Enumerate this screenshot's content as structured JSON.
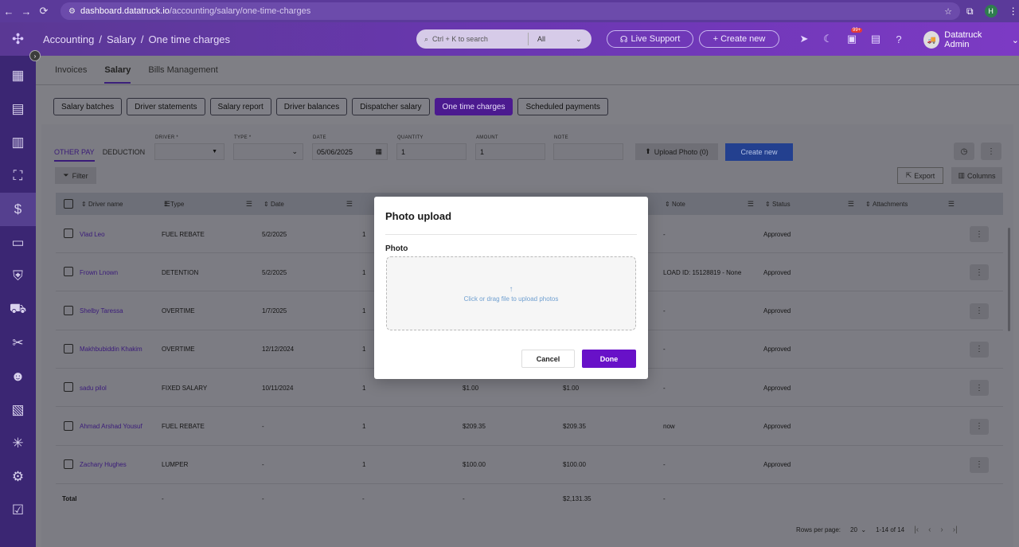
{
  "browser": {
    "url_host": "dashboard.datatruck.io",
    "url_path": "/accounting/salary/one-time-charges",
    "profile_initial": "H"
  },
  "header": {
    "breadcrumb": [
      "Accounting",
      "/",
      "Salary",
      "/",
      "One time charges"
    ],
    "search_placeholder": "Ctrl + K to search",
    "search_scope": "All",
    "live_support": "Live Support",
    "create_new": "+ Create new",
    "notif_badge": "99+",
    "user_name": "Datatruck Admin"
  },
  "tabs": [
    "Invoices",
    "Salary",
    "Bills Management"
  ],
  "active_tab": "Salary",
  "subtabs": [
    "Salary batches",
    "Driver statements",
    "Salary report",
    "Driver balances",
    "Dispatcher salary",
    "One time charges",
    "Scheduled payments"
  ],
  "active_subtab": "One time charges",
  "mode_tabs": [
    "OTHER PAY",
    "DEDUCTION"
  ],
  "form": {
    "driver_label": "DRIVER *",
    "type_label": "TYPE *",
    "date_label": "DATE",
    "date_value": "05/06/2025",
    "quantity_label": "QUANTITY",
    "quantity_value": "1",
    "amount_label": "AMOUNT",
    "amount_value": "1",
    "note_label": "NOTE",
    "upload_photo": "Upload Photo (0)",
    "create_new": "Create new"
  },
  "toolbar": {
    "filter": "Filter",
    "export": "Export",
    "columns": "Columns"
  },
  "table": {
    "headers": [
      "Driver name",
      "Type",
      "Date",
      "Note",
      "Status",
      "Attachments"
    ],
    "rows": [
      {
        "driver": "Vlad Leo",
        "type": "FUEL REBATE",
        "date": "5/2/2025",
        "qty": "1",
        "amount": "",
        "total": "",
        "note": "-",
        "status": "Approved"
      },
      {
        "driver": "Frown Lnown",
        "type": "DETENTION",
        "date": "5/2/2025",
        "qty": "1",
        "amount": "",
        "total": "",
        "note": "LOAD ID: 15128819 - None",
        "status": "Approved"
      },
      {
        "driver": "Shelby Taressa",
        "type": "OVERTIME",
        "date": "1/7/2025",
        "qty": "1",
        "amount": "",
        "total": "",
        "note": "-",
        "status": "Approved"
      },
      {
        "driver": "Makhbubiddin Khakim",
        "type": "OVERTIME",
        "date": "12/12/2024",
        "qty": "1",
        "amount": "",
        "total": "",
        "note": "-",
        "status": "Approved"
      },
      {
        "driver": "sadu pilol",
        "type": "FIXED SALARY",
        "date": "10/11/2024",
        "qty": "1",
        "amount": "$1.00",
        "total": "$1.00",
        "note": "-",
        "status": "Approved"
      },
      {
        "driver": "Ahmad Arshad Yousuf",
        "type": "FUEL REBATE",
        "date": "-",
        "qty": "1",
        "amount": "$209.35",
        "total": "$209.35",
        "note": "now",
        "status": "Approved"
      },
      {
        "driver": "Zachary Hughes",
        "type": "LUMPER",
        "date": "-",
        "qty": "1",
        "amount": "$100.00",
        "total": "$100.00",
        "note": "-",
        "status": "Approved"
      }
    ],
    "total_row": {
      "label": "Total",
      "type": "-",
      "date": "-",
      "qty": "-",
      "amount": "-",
      "total": "$2,131.35",
      "note": "-"
    }
  },
  "pagination": {
    "rows_label": "Rows per page:",
    "rows_value": "20",
    "range": "1-14 of 14"
  },
  "modal": {
    "title": "Photo upload",
    "field_label": "Photo",
    "drop_text": "Click or drag file to upload photos",
    "cancel": "Cancel",
    "done": "Done"
  },
  "colors": {
    "accent": "#6811c8",
    "header": "#6a37b1",
    "sidebar": "#3b2673"
  }
}
